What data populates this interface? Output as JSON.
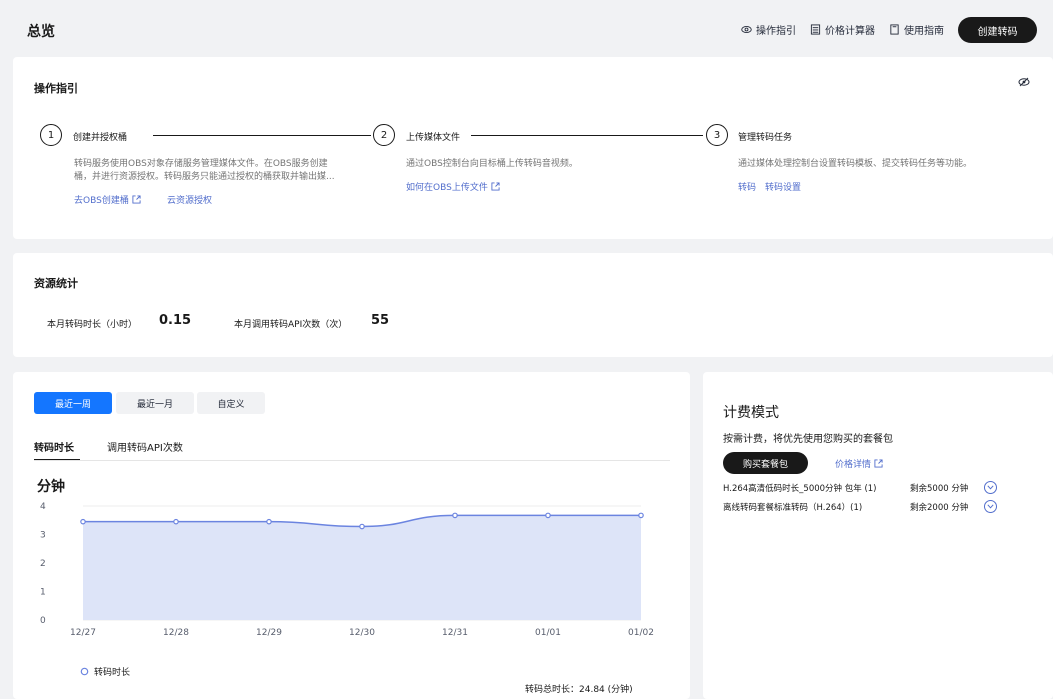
{
  "header": {
    "title": "总览",
    "links": {
      "guide": "操作指引",
      "calculator": "价格计算器",
      "manual": "使用指南"
    },
    "create_button": "创建转码"
  },
  "guide": {
    "title": "操作指引",
    "steps": [
      {
        "num": "1",
        "title": "创建并授权桶",
        "desc1": "转码服务使用OBS对象存储服务管理媒体文件。在OBS服务创建",
        "desc2": "桶，并进行资源授权。转码服务只能通过授权的桶获取并输出媒...",
        "link1": "去OBS创建桶",
        "link2": "云资源授权"
      },
      {
        "num": "2",
        "title": "上传媒体文件",
        "desc1": "通过OBS控制台向目标桶上传转码音视频。",
        "link1": "如何在OBS上传文件"
      },
      {
        "num": "3",
        "title": "管理转码任务",
        "desc1": "通过媒体处理控制台设置转码模板、提交转码任务等功能。",
        "link1": "转码",
        "link2": "转码设置"
      }
    ]
  },
  "resources": {
    "title": "资源统计",
    "duration_label": "本月转码时长（小时）",
    "duration_value": "0.15",
    "api_label": "本月调用转码API次数（次）",
    "api_value": "55"
  },
  "usage": {
    "ranges": [
      "最近一周",
      "最近一月",
      "自定义"
    ],
    "active_range": "最近一周",
    "tabs": [
      "转码时长",
      "调用转码API次数"
    ],
    "active_tab": "转码时长",
    "unit": "分钟",
    "legend": "转码时长",
    "total": "转码总时长：24.84 (分钟)"
  },
  "chart_data": {
    "type": "area",
    "x": [
      "12/27",
      "12/28",
      "12/29",
      "12/30",
      "12/31",
      "01/01",
      "01/02"
    ],
    "series": [
      {
        "name": "转码时长",
        "values": [
          3.45,
          3.45,
          3.45,
          3.28,
          3.67,
          3.67,
          3.67
        ]
      }
    ],
    "ylabel": "分钟",
    "yticks": [
      0,
      1,
      2,
      3,
      4
    ],
    "ylim": [
      0,
      4
    ],
    "grid": true,
    "legend_position": "bottom-left",
    "color": "#6b84e0",
    "fill": "#dde4f8"
  },
  "billing": {
    "title": "计费模式",
    "subtitle": "按需计费，将优先使用您购买的套餐包",
    "buy_button": "购买套餐包",
    "price_link": "价格详情",
    "packages": [
      {
        "name": "H.264高清低码时长_5000分钟 包年 (1)",
        "remain": "剩余5000 分钟"
      },
      {
        "name": "离线转码套餐标准转码（H.264）(1)",
        "remain": "剩余2000 分钟"
      }
    ]
  },
  "colors": {
    "accent": "#1476ff",
    "link": "#526ecc",
    "dark_button": "#191919"
  }
}
